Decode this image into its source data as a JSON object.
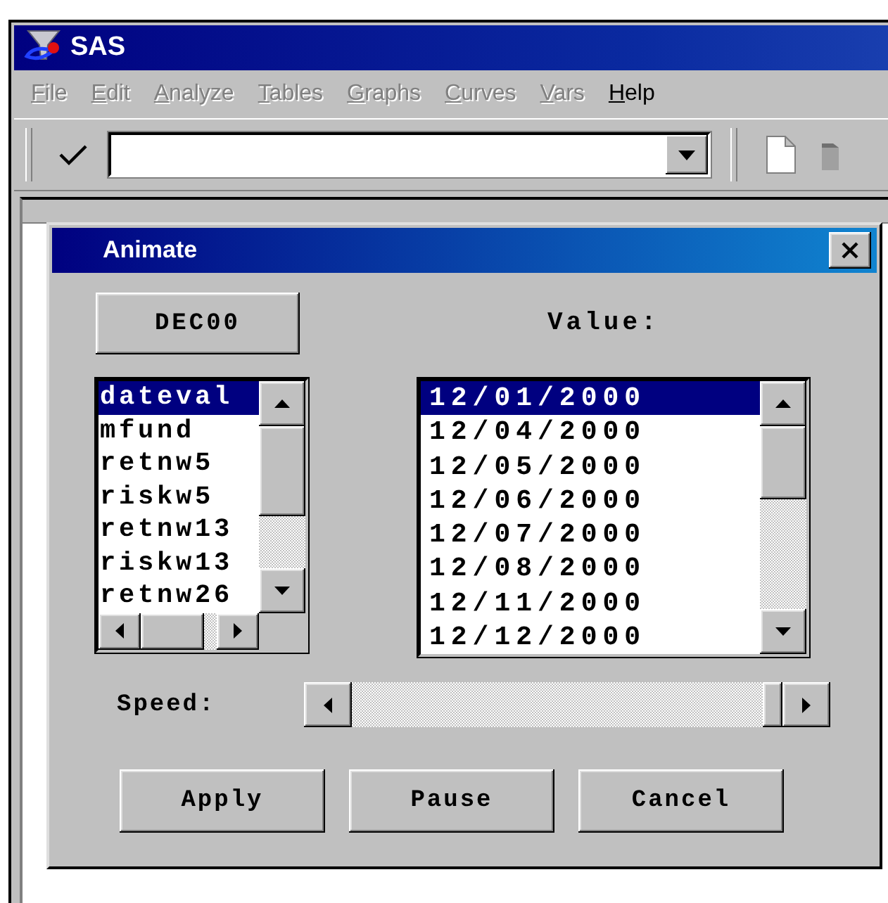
{
  "window": {
    "title": "SAS"
  },
  "menu": [
    {
      "label": "File",
      "disabled": true
    },
    {
      "label": "Edit",
      "disabled": true
    },
    {
      "label": "Analyze",
      "disabled": true
    },
    {
      "label": "Tables",
      "disabled": true
    },
    {
      "label": "Graphs",
      "disabled": true
    },
    {
      "label": "Curves",
      "disabled": true
    },
    {
      "label": "Vars",
      "disabled": true
    },
    {
      "label": "Help",
      "disabled": false
    }
  ],
  "dialog": {
    "title": "Animate",
    "variable_button": "DEC00",
    "value_label": "Value:",
    "variables": [
      {
        "label": "dateval",
        "selected": true
      },
      {
        "label": "mfund",
        "selected": false
      },
      {
        "label": "retnw5",
        "selected": false
      },
      {
        "label": "riskw5",
        "selected": false
      },
      {
        "label": "retnw13",
        "selected": false
      },
      {
        "label": "riskw13",
        "selected": false
      },
      {
        "label": "retnw26",
        "selected": false
      }
    ],
    "values": [
      {
        "label": "12/01/2000",
        "selected": true
      },
      {
        "label": "12/04/2000",
        "selected": false
      },
      {
        "label": "12/05/2000",
        "selected": false
      },
      {
        "label": "12/06/2000",
        "selected": false
      },
      {
        "label": "12/07/2000",
        "selected": false
      },
      {
        "label": "12/08/2000",
        "selected": false
      },
      {
        "label": "12/11/2000",
        "selected": false
      },
      {
        "label": "12/12/2000",
        "selected": false
      }
    ],
    "speed": {
      "label": "Speed:",
      "level": 1
    },
    "buttons": [
      "Apply",
      "Pause",
      "Cancel"
    ]
  }
}
